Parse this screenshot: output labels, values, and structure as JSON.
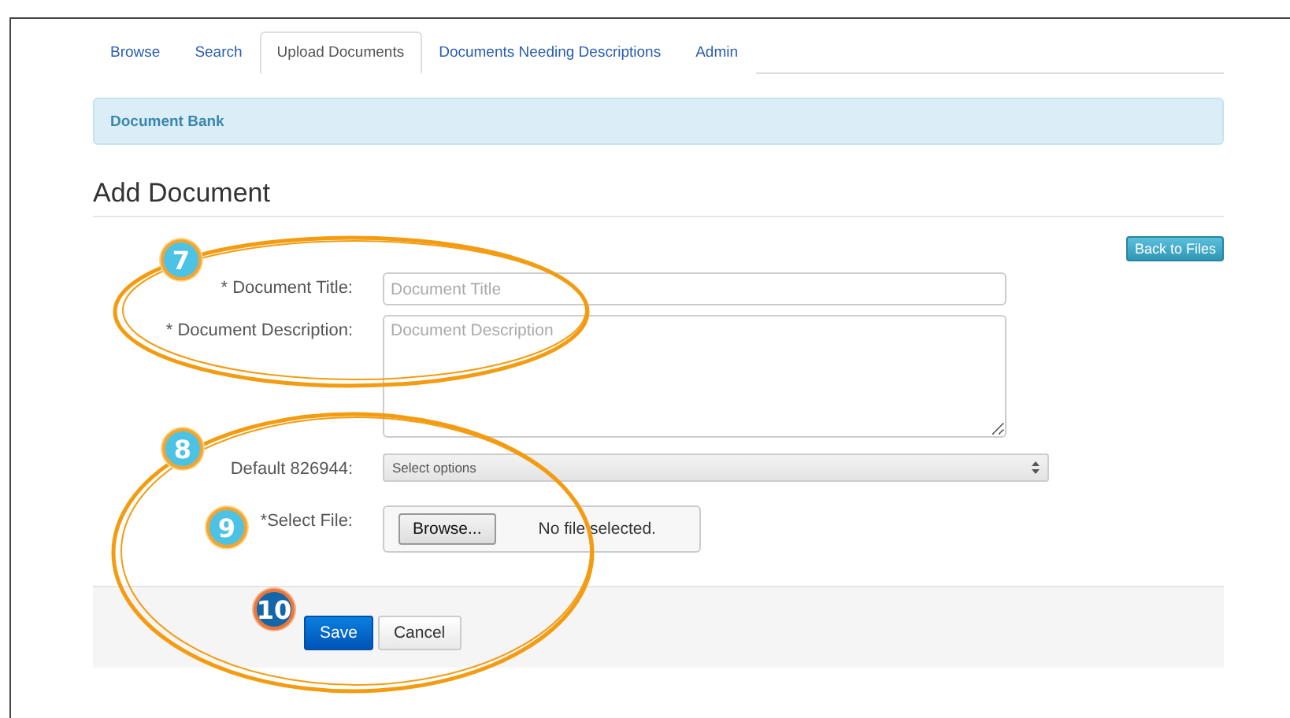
{
  "tabs": [
    {
      "label": "Browse",
      "selected": false
    },
    {
      "label": "Search",
      "selected": false
    },
    {
      "label": "Upload Documents",
      "selected": true
    },
    {
      "label": "Documents Needing Descriptions",
      "selected": false
    },
    {
      "label": "Admin",
      "selected": false
    }
  ],
  "alert": "Document Bank",
  "heading": "Add Document",
  "back_button": "Back to Files",
  "fields": [
    {
      "kind": "text",
      "label": "* Document Title:",
      "placeholder": "Document Title"
    },
    {
      "kind": "textarea",
      "label": "* Document Description:",
      "placeholder": "Document Description"
    },
    {
      "kind": "select",
      "label": "Default 826944:",
      "value": "Select options"
    },
    {
      "kind": "file",
      "label": "*Select File:",
      "button": "Browse...",
      "value": "No file selected."
    }
  ],
  "buttons": [
    {
      "label": "Save",
      "kind": "primary"
    },
    {
      "label": "Cancel",
      "kind": "default"
    }
  ],
  "annotations": {
    "highlights": [
      {
        "kind": "ellipse"
      },
      {
        "kind": "ellipse"
      }
    ],
    "callouts": [
      {
        "number": "7",
        "kind": "light"
      },
      {
        "number": "8",
        "kind": "light"
      },
      {
        "number": "9",
        "kind": "light"
      },
      {
        "number": "10",
        "kind": "dark"
      }
    ]
  }
}
